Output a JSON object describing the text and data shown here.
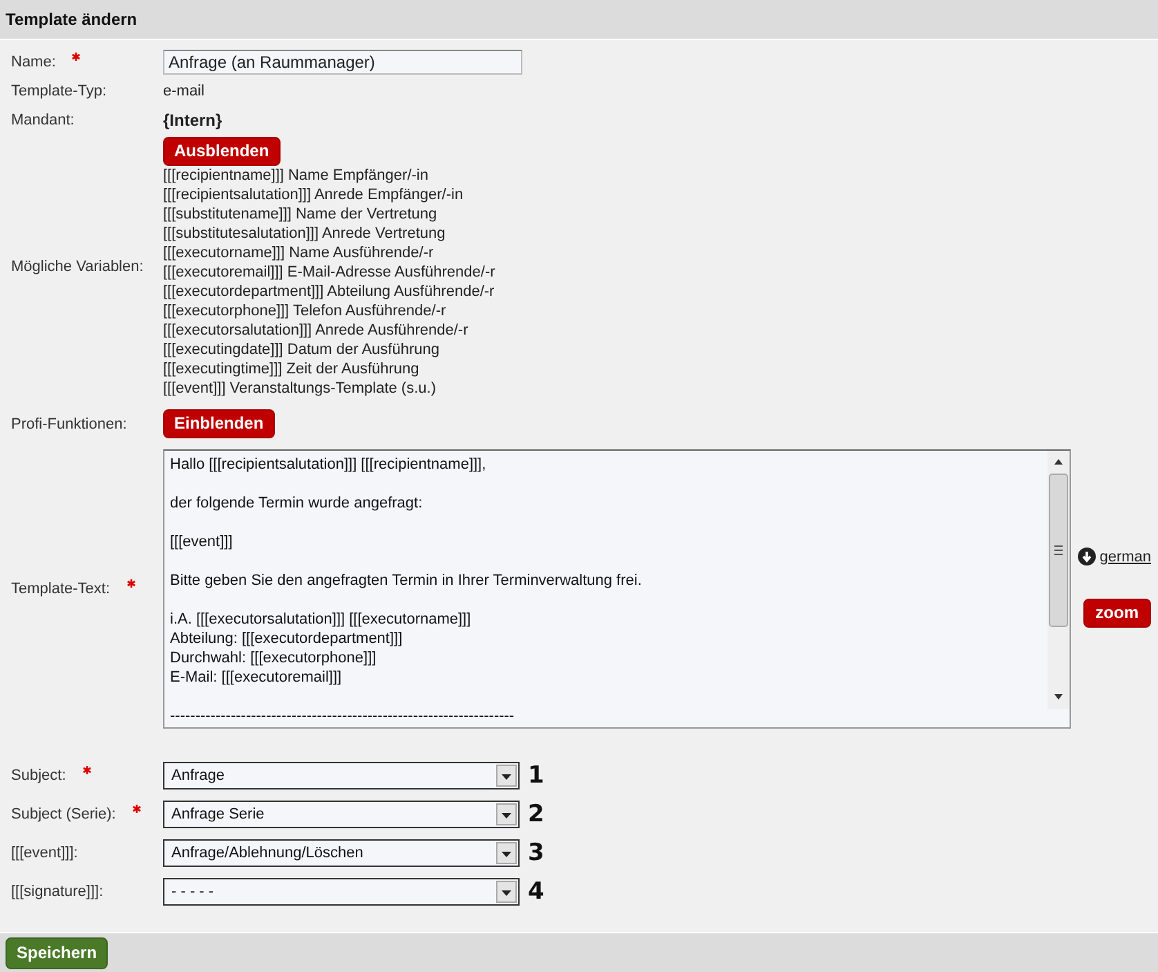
{
  "header": {
    "title": "Template ändern"
  },
  "fields": [
    {
      "kind": "input",
      "label": "Name:",
      "required": true,
      "value": "Anfrage (an Raummanager)"
    },
    {
      "kind": "text",
      "label": "Template-Typ:",
      "required": false,
      "value": "e-mail"
    },
    {
      "kind": "bold",
      "label": "Mandant:",
      "required": false,
      "value": "{Intern}"
    },
    {
      "kind": "variables",
      "label": "Mögliche Variablen:",
      "required": false,
      "button": "Ausblenden",
      "items": [
        "[[[recipientname]]] Name Empfänger/-in",
        "[[[recipientsalutation]]] Anrede Empfänger/-in",
        "[[[substitutename]]] Name der Vertretung",
        "[[[substitutesalutation]]] Anrede Vertretung",
        "[[[executorname]]] Name Ausführende/-r",
        "[[[executoremail]]] E-Mail-Adresse Ausführende/-r",
        "[[[executordepartment]]] Abteilung Ausführende/-r",
        "[[[executorphone]]] Telefon Ausführende/-r",
        "[[[executorsalutation]]] Anrede Ausführende/-r",
        "[[[executingdate]]] Datum der Ausführung",
        "[[[executingtime]]] Zeit der Ausführung",
        "[[[event]]] Veranstaltungs-Template (s.u.)"
      ]
    },
    {
      "kind": "toggle",
      "label": "Profi-Funktionen:",
      "required": false,
      "button": "Einblenden"
    },
    {
      "kind": "editor",
      "label": "Template-Text:",
      "required": true,
      "paragraphs": [
        "Hallo [[[recipientsalutation]]] [[[recipientname]]],",
        "der folgende Termin wurde angefragt:",
        "[[[event]]]",
        "Bitte geben Sie den angefragten Termin in Ihrer Terminverwaltung frei.",
        "i.A. [[[executorsalutation]]] [[[executorname]]]\nAbteilung: [[[executordepartment]]]\nDurchwahl: [[[executorphone]]]\nE-Mail: [[[executoremail]]]",
        "--------------------------------------------------------------------"
      ],
      "language_link": "german",
      "zoom_button": "zoom"
    }
  ],
  "selects": [
    {
      "label": "Subject:",
      "required": true,
      "value": "Anfrage",
      "number": "1"
    },
    {
      "label": "Subject (Serie):",
      "required": true,
      "value": "Anfrage Serie",
      "number": "2"
    },
    {
      "label": "[[[event]]]:",
      "required": false,
      "value": "Anfrage/Ablehnung/Löschen",
      "number": "3"
    },
    {
      "label": "[[[signature]]]:",
      "required": false,
      "value": "- - - - -",
      "number": "4"
    }
  ],
  "save_button": "Speichern"
}
